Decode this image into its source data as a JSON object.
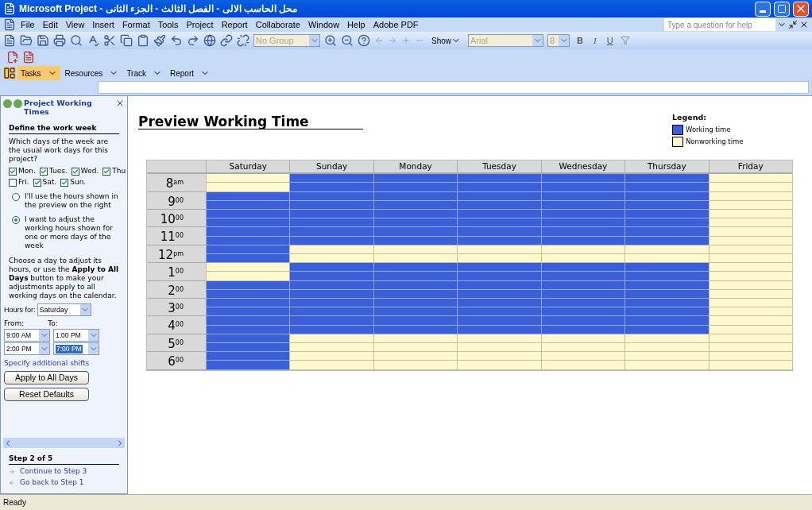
{
  "window": {
    "title": "Microsoft Project - محل الحاسب الالى - الفصل الثالث - الجزء الثانى"
  },
  "menu": [
    "File",
    "Edit",
    "View",
    "Insert",
    "Format",
    "Tools",
    "Project",
    "Report",
    "Collaborate",
    "Window",
    "Help",
    "Adobe PDF"
  ],
  "help_box": {
    "placeholder": "Type a question for help"
  },
  "toolbar": {
    "group": "No Group",
    "show": "Show",
    "font": "Arial",
    "size": "8",
    "bold": "B",
    "italic": "I",
    "underline": "U"
  },
  "guide_tabs": [
    {
      "label": "Tasks",
      "selected": true
    },
    {
      "label": "Resources",
      "selected": false
    },
    {
      "label": "Track",
      "selected": false
    },
    {
      "label": "Report",
      "selected": false
    }
  ],
  "task_pane": {
    "title": "Project Working Times",
    "heading": "Define the work week",
    "question": "Which days of the week are the usual work days for this project?",
    "days": [
      {
        "label": "Mon.",
        "checked": true
      },
      {
        "label": "Tues.",
        "checked": true
      },
      {
        "label": "Wed.",
        "checked": true
      },
      {
        "label": "Thu",
        "checked": true
      },
      {
        "label": "Fri.",
        "checked": false
      },
      {
        "label": "Sat.",
        "checked": true
      },
      {
        "label": "Sun.",
        "checked": true
      }
    ],
    "options": [
      {
        "label": "I'll use the hours shown in the preview on the right",
        "selected": false
      },
      {
        "label": "I want to adjust the working hours shown for one or more days of the week",
        "selected": true
      }
    ],
    "instructions": "Choose a day to adjust its hours, or use the **Apply to All Days** button to make your adjustments apply to all working days on the calendar.",
    "hours_for_label": "Hours for:",
    "hours_for": "Saturday",
    "from_label": "From:",
    "to_label": "To:",
    "shifts": [
      {
        "from": "9:00 AM",
        "to": "1:00 PM",
        "to_selected": false
      },
      {
        "from": "2:00 PM",
        "to": "7:00 PM",
        "to_selected": true
      }
    ],
    "link": "Specify additional shifts",
    "buttons": [
      "Apply to All Days",
      "Reset Defaults"
    ],
    "step": "Step 2 of 5",
    "next": "Continue to Step 3",
    "back": "Go back to Step 1"
  },
  "preview": {
    "title": "Preview Working Time",
    "legend_title": "Legend:",
    "legend": [
      {
        "label": "Working time",
        "color": "#3b5fd9"
      },
      {
        "label": "Nonworking time",
        "color": "#fdf8d0"
      }
    ],
    "hours": [
      "8$^{am}$",
      "9$^{00}$",
      "10$^{00}$",
      "11$^{00}$",
      "12$^{pm}$",
      "1$^{00}$",
      "2$^{00}$",
      "3$^{00}$",
      "4$^{00}$",
      "5$^{00}$",
      "6$^{00}$"
    ],
    "days": [
      {
        "name": "Saturday",
        "working": [
          false,
          true,
          true,
          true,
          true,
          false,
          true,
          true,
          true,
          true,
          true
        ]
      },
      {
        "name": "Sunday",
        "working": [
          true,
          true,
          true,
          true,
          false,
          true,
          true,
          true,
          true,
          false,
          false
        ]
      },
      {
        "name": "Monday",
        "working": [
          true,
          true,
          true,
          true,
          false,
          true,
          true,
          true,
          true,
          false,
          false
        ]
      },
      {
        "name": "Tuesday",
        "working": [
          true,
          true,
          true,
          true,
          false,
          true,
          true,
          true,
          true,
          false,
          false
        ]
      },
      {
        "name": "Wednesday",
        "working": [
          true,
          true,
          true,
          true,
          false,
          true,
          true,
          true,
          true,
          false,
          false
        ]
      },
      {
        "name": "Thursday",
        "working": [
          true,
          true,
          true,
          true,
          false,
          true,
          true,
          true,
          true,
          false,
          false
        ]
      },
      {
        "name": "Friday",
        "working": [
          false,
          false,
          false,
          false,
          false,
          false,
          false,
          false,
          false,
          false,
          false
        ]
      }
    ]
  },
  "status_bar": "Ready"
}
